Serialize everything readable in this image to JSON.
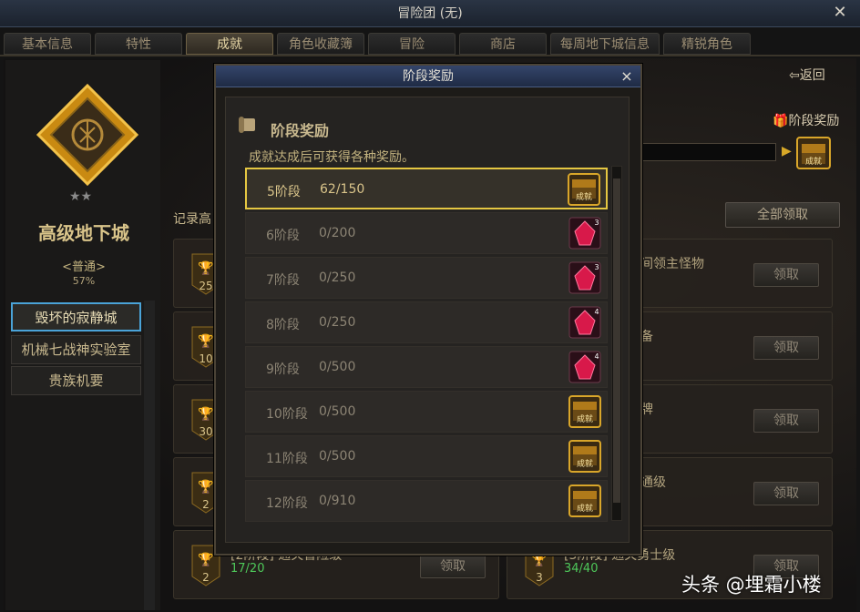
{
  "window": {
    "title": "冒险团 (无)",
    "close": "✕"
  },
  "tabs": [
    "基本信息",
    "特性",
    "成就",
    "角色收藏簿",
    "冒险",
    "商店",
    "每周地下城信息",
    "精锐角色"
  ],
  "left": {
    "dungeon_title": "高级地下城",
    "difficulty": "<普通>",
    "percent": "57%",
    "stars": "★★",
    "categories": [
      "毁坏的寂静城",
      "机械七战神实验室",
      "贵族机要"
    ]
  },
  "right": {
    "back": "返回",
    "stage_reward_link": "阶段奖励",
    "claim_all": "全部领取",
    "record_label": "记录高",
    "chest_label": "成就",
    "cards": [
      {
        "badge": "25",
        "text": "中间领主怪物",
        "progress": "",
        "button": "领取"
      },
      {
        "badge": "10",
        "text": "装备",
        "progress": "",
        "button": "领取"
      },
      {
        "badge": "30",
        "text": "金牌",
        "progress": "",
        "button": "领取"
      },
      {
        "badge": "2",
        "text": "普通级",
        "progress": "",
        "button": "领取"
      },
      {
        "badge": "2",
        "text": "[2阶段] 通关冒险级",
        "progress": "17/20",
        "button": "领取"
      },
      {
        "badge": "3",
        "text": "[3阶段] 通关勇士级",
        "progress": "34/40",
        "button": "领取"
      }
    ]
  },
  "modal": {
    "title": "阶段奖励",
    "close": "×",
    "heading": "阶段奖励",
    "subtitle": "成就达成后可获得各种奖励。",
    "rows": [
      {
        "label": "5阶段",
        "progress": "62/150",
        "reward": "chest",
        "count": "",
        "reward_label": "成就",
        "selected": true
      },
      {
        "label": "6阶段",
        "progress": "0/200",
        "reward": "crystal",
        "count": "3",
        "reward_label": "",
        "selected": false
      },
      {
        "label": "7阶段",
        "progress": "0/250",
        "reward": "crystal",
        "count": "3",
        "reward_label": "",
        "selected": false
      },
      {
        "label": "8阶段",
        "progress": "0/250",
        "reward": "crystal",
        "count": "4",
        "reward_label": "",
        "selected": false
      },
      {
        "label": "9阶段",
        "progress": "0/500",
        "reward": "crystal",
        "count": "4",
        "reward_label": "",
        "selected": false
      },
      {
        "label": "10阶段",
        "progress": "0/500",
        "reward": "chest",
        "count": "",
        "reward_label": "成就",
        "selected": false
      },
      {
        "label": "11阶段",
        "progress": "0/500",
        "reward": "chest",
        "count": "",
        "reward_label": "成就",
        "selected": false
      },
      {
        "label": "12阶段",
        "progress": "0/910",
        "reward": "chest",
        "count": "",
        "reward_label": "成就",
        "selected": false
      }
    ]
  },
  "watermark": "头条 @埋霜小楼",
  "colors": {
    "accent_gold": "#e5c742",
    "select_blue": "#4aa3d8",
    "progress_green": "#4ec85a"
  }
}
